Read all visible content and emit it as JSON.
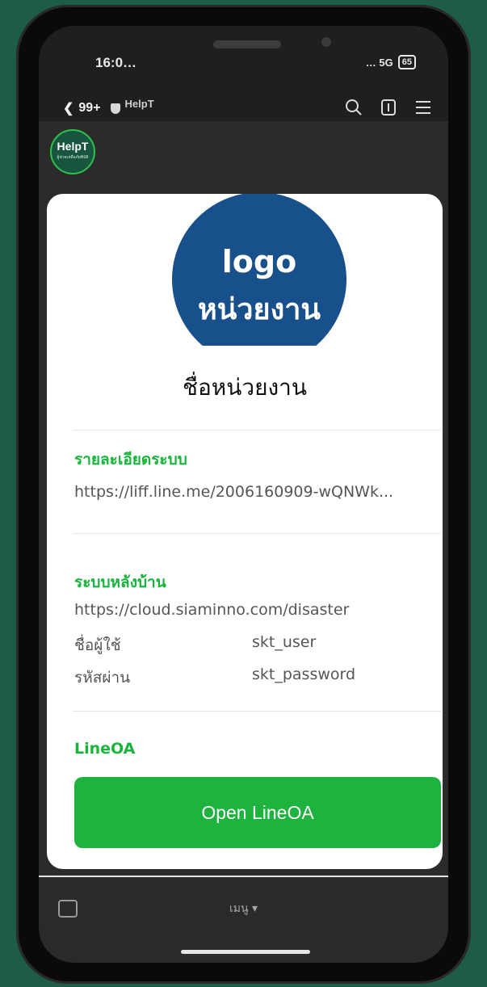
{
  "status_bar": {
    "time": "16:0…",
    "network": "… 5G",
    "battery": "65"
  },
  "nav": {
    "back_count": "99+",
    "chat_name": "HelpT",
    "icons": [
      "search-icon",
      "notes-icon",
      "menu-icon"
    ]
  },
  "avatar": {
    "name": "HelpT",
    "subtitle": "ผู้ช่วยเหลือภัยพิบัติ"
  },
  "card": {
    "logo": {
      "line1": "logo",
      "line2": "หน่วยงาน",
      "color": "#17508a"
    },
    "org_name": "ชื่อหน่วยงาน",
    "system_details": {
      "title": "รายละเอียดระบบ",
      "url": "https://liff.line.me/2006160909-wQNWk..."
    },
    "backend": {
      "title": "ระบบหลังบ้าน",
      "url": "https://cloud.siaminno.com/disaster",
      "username_label": "ชื่อผู้ใช้",
      "username_value": "skt_user",
      "password_label": "รหัสผ่าน",
      "password_value": "skt_password"
    },
    "lineoa": {
      "title": "LineOA",
      "button_label": "Open LineOA"
    }
  },
  "bottom": {
    "menu_label": "เมนู ▾"
  },
  "colors": {
    "accent": "#1db33e",
    "background": "#1d5c48"
  }
}
